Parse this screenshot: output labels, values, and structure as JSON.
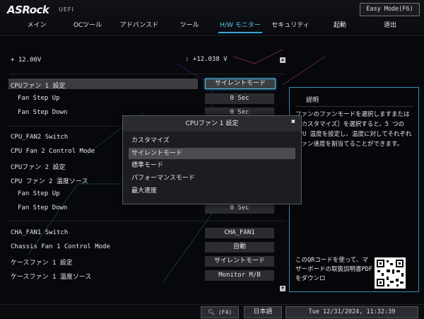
{
  "header": {
    "logo": "ASRock",
    "logo_sub": "UEFI",
    "easy_mode": "Easy Mode(F6)"
  },
  "menu": [
    {
      "label": "メイン",
      "active": false
    },
    {
      "label": "OCツール",
      "active": false
    },
    {
      "label": "アドバンスド",
      "active": false
    },
    {
      "label": "ツール",
      "active": false
    },
    {
      "label": "H/W モニター",
      "active": true
    },
    {
      "label": "セキュリティ",
      "active": false
    },
    {
      "label": "起動",
      "active": false
    },
    {
      "label": "退出",
      "active": false
    }
  ],
  "voltage": {
    "label": "+ 12.00V",
    "value": ": +12.038 V"
  },
  "rows": [
    {
      "label": "CPUファン 1 設定",
      "value": "サイレントモード"
    },
    {
      "label": "Fan Step Up",
      "value": "0 Sec"
    },
    {
      "label": "Fan Step Down",
      "value": "0 Sec"
    },
    {
      "label": "CPU_FAN2 Switch",
      "value": ""
    },
    {
      "label": "CPU Fan 2 Control Mode",
      "value": ""
    },
    {
      "label": "CPUファン 2 設定",
      "value": ""
    },
    {
      "label": "CPU ファン 2 温度ソース",
      "value": ""
    },
    {
      "label": "Fan Step Up",
      "value": ""
    },
    {
      "label": "Fan Step Down",
      "value": "0 Sec"
    },
    {
      "label": "CHA_FAN1 Switch",
      "value": "CHA_FAN1"
    },
    {
      "label": "Chassis Fan 1 Control Mode",
      "value": "自動"
    },
    {
      "label": "ケースファン 1 設定",
      "value": "サイレントモード"
    },
    {
      "label": "ケースファン 1 温度ソース",
      "value": "Monitor M/B"
    }
  ],
  "description": {
    "title": "説明",
    "text": "ファンのファンモードを選択しますまたは［カスタマイズ］を選択すると、5 つの CPU 温度を設定し、温度に対してそれぞれファン速度を割当てることができます。",
    "qr_text": "このQRコードを使って、マザーボードの取扱説明書PDFをダウンロ"
  },
  "popup": {
    "title": "CPUファン 1 設定",
    "options": [
      {
        "label": "カスタマイズ",
        "selected": false
      },
      {
        "label": "サイレントモード",
        "selected": true
      },
      {
        "label": "標準モード",
        "selected": false
      },
      {
        "label": "パフォーマンスモード",
        "selected": false
      },
      {
        "label": "最大速度",
        "selected": false
      }
    ]
  },
  "footer": {
    "search": "(F4)",
    "language": "日本語",
    "datetime": "Tue 12/31/2024, 11:32:39"
  },
  "colors": {
    "accent": "#3aa9e0",
    "background": "#07080c"
  }
}
